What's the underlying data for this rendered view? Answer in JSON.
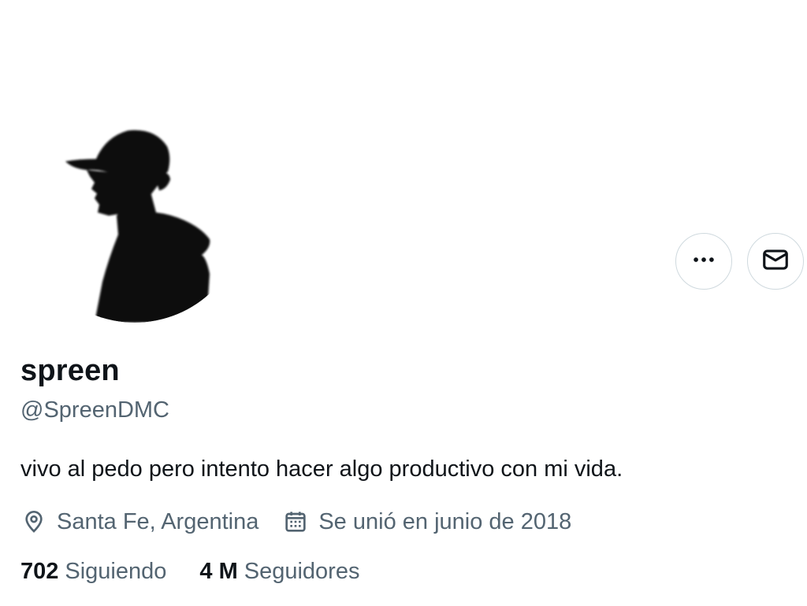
{
  "profile": {
    "display_name": "spreen",
    "handle": "@SpreenDMC",
    "bio": "vivo al pedo pero intento hacer algo productivo con mi vida.",
    "location": "Santa Fe, Argentina",
    "joined": "Se unió en junio de 2018",
    "avatar_icon": "silhouette-with-cap"
  },
  "actions": {
    "more_icon": "more-icon",
    "message_icon": "message-icon"
  },
  "stats": {
    "following_count": "702",
    "following_label": "Siguiendo",
    "followers_count": "4 M",
    "followers_label": "Seguidores"
  },
  "colors": {
    "text_primary": "#0f1419",
    "text_secondary": "#536471",
    "border": "#cfd9de"
  }
}
